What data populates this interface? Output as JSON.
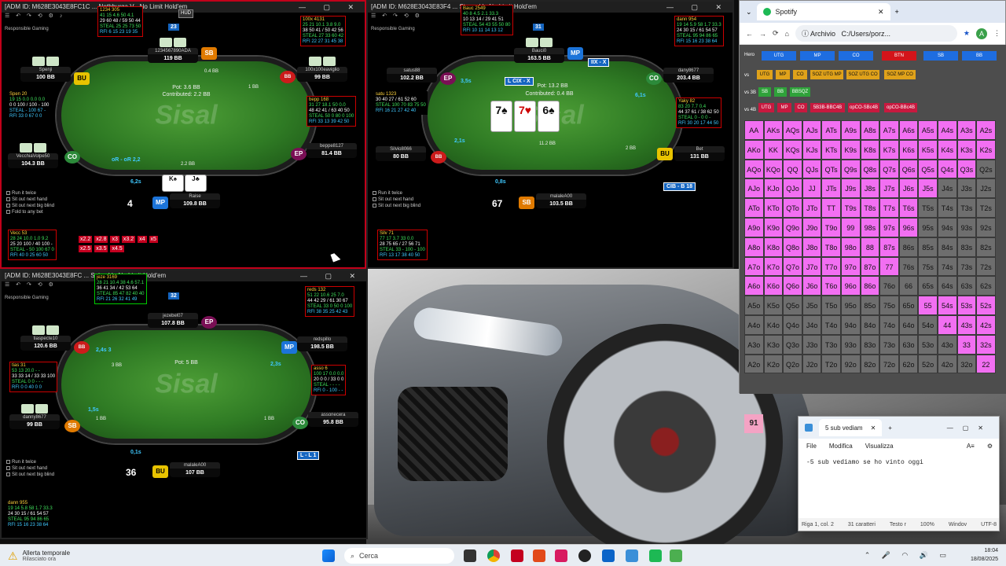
{
  "tables": [
    {
      "title": "[ADM ID: M628E3043E8FC1C",
      "title_tail": "Nothburga V - No Limit Hold'em",
      "hand_no": "4",
      "pot": "Pot: 3.6 BB",
      "contrib": "Contributed: 2.2 BB",
      "logo": "Sisal",
      "resp": "Responsible Gaming",
      "hero": {
        "name": "Raise",
        "stack": "109.8 BB",
        "pos": "MP"
      },
      "hero_cards": [
        "K♠",
        "J♣"
      ],
      "seats": [
        {
          "name": "1234567890ADA",
          "stack": "119 BB",
          "pos": "SB"
        },
        {
          "name": "Spenji",
          "stack": "100 BB",
          "pos": "BU"
        },
        {
          "name": "100x100eaviglio",
          "stack": "99 BB",
          "pos": "BB"
        },
        {
          "name": "VecchiaVolpe50",
          "stack": "104.3 BB",
          "pos": "CO"
        },
        {
          "name": "beppe8127",
          "stack": "81.4 BB",
          "pos": "EP"
        }
      ],
      "bets": [
        "0.4 BB",
        "1 BB",
        "2.2 BB"
      ],
      "timer": "6,2s",
      "range_label": "oR - oR 2,2",
      "num_badge": "23",
      "checks": [
        "Run it twice",
        "Sit out next hand",
        "Sit out next big blind",
        "Fold to any bet"
      ],
      "sizes": [
        "x2.2",
        "x2.8",
        "x3",
        "x3.2",
        "x4",
        "x5",
        "x2.5",
        "x3.5",
        "x4.5"
      ],
      "hud_left": [
        "Vecc 53",
        "28 24 10.0 1.0 9.2",
        "25 20 100 / 40 100 -",
        "STEAL - 50 100 67 0",
        "RFI 40 0 25 60 50"
      ],
      "hud_top": [
        "1234 305",
        "41 15 4.6 50 4.1",
        "29 60 48 / 59 50 44",
        "STEAL 25 25 73 50",
        "RFI 6 15 23 19 35"
      ],
      "hud_right": [
        "100x 4131",
        "25 21 10.1 3.8 9.0",
        "38 50 41 / 50 42 56",
        "STEAL 27 33 60 42",
        "RFI 22 27 31 45 38"
      ],
      "hud_spen": [
        "Spen 20",
        "19 15 0.0 0.0 0.0",
        "0 0 100 / 100 - 100",
        "STEAL - 100 67 -",
        "RFI 33 0 67 0 0"
      ],
      "hud_bepp": [
        "bepp 168",
        "31 27 18.1 50 0.0",
        "48 42 41 / 63 40 50",
        "STEAL 50 0 80 0 100",
        "RFI 33 13 39 42 50"
      ]
    },
    {
      "title": "[ADM ID: M628E3043E83F4",
      "title_tail": "Sirene V - No Limit Hold'em",
      "hand_no": "67",
      "pot": "Pot: 13.2 BB",
      "contrib": "Contributed: 0.4 BB",
      "logo": "Sisal",
      "resp": "Responsible Gaming",
      "hero": {
        "name": "malaleA00",
        "stack": "103.5 BB",
        "pos": "SB"
      },
      "board": [
        "7♠",
        "7♥",
        "6♠"
      ],
      "seats": [
        {
          "name": "Bauci0",
          "stack": "163.5 BB",
          "pos": "MP"
        },
        {
          "name": "satus88",
          "stack": "102.2 BB",
          "pos": "EP"
        },
        {
          "name": "dany8677",
          "stack": "203.4 BB",
          "pos": "CO"
        },
        {
          "name": "Silvio8066",
          "stack": "80 BB",
          "pos": "BB"
        },
        {
          "name": "Bet",
          "stack": "131 BB",
          "pos": "BU"
        }
      ],
      "bets": [
        "11.2 BB",
        "2 BB"
      ],
      "timer": "0,8s",
      "num_badge": "31",
      "range_label": "L CIX - X",
      "range_label2": "IIX - X",
      "range_label3": "CIB - B 18",
      "checks": [
        "Run it twice",
        "Sit out next hand",
        "Sit out next big blind"
      ],
      "hud_top": [
        "Bauc 2549",
        "40 8 4.5 2.1 33.3",
        "10 13 14 / 29 41 51",
        "STEAL 54 43 55 50 80",
        "RFI 10 11 14 13 12"
      ],
      "hud_right": [
        "dann 954",
        "19 14 5.9 58 1.7 33.3",
        "24 30 15 / 61 54 57",
        "STEAL 95 94 86 65",
        "RFI 15 16 23 38 64"
      ],
      "hud_left": [
        "satu 1323",
        "30 40 27 / 61 52 60",
        "STEAL 100 70 83 75 50",
        "RFI 16 21 27 42 40"
      ],
      "hud_yaky": [
        "Yaky 82",
        "83 20 7.7 0.4",
        "44 37 61 / 38 62 50",
        "STEAL 0 - 0 0 -",
        "RFI 30 20 17 44 50"
      ],
      "hud_silv": [
        "Silv 71",
        "77 17 3.7 33 0.0",
        "28 75 65 / 27 56 71",
        "STEAL 33 - 100 - 100",
        "RFI 13 17 38 40 50"
      ],
      "tm1": "3,5s",
      "tm2": "2,1s",
      "tm3": "6,1s"
    },
    {
      "title": "[ADM ID: M628E3043E8FC",
      "title_tail": "Saipn V - No Limit Hold'em",
      "hand_no": "36",
      "pot": "Pot: 5 BB",
      "logo": "Sisal",
      "resp": "Responsible Gaming",
      "hero": {
        "name": "malaleA00",
        "stack": "107 BB",
        "pos": "BU"
      },
      "seats": [
        {
          "name": "jezebel07",
          "stack": "107.8 BB",
          "pos": "EP"
        },
        {
          "name": "tiaspecte10",
          "stack": "120.6 BB",
          "pos": "BB"
        },
        {
          "name": "redspillo",
          "stack": "198.5 BB",
          "pos": "MP"
        },
        {
          "name": "danny8677",
          "stack": "99 BB",
          "pos": "SB"
        },
        {
          "name": "assonecera",
          "stack": "95.8 BB",
          "pos": "CO"
        }
      ],
      "bets": [
        "3 BB",
        "1 BB",
        "1 BB"
      ],
      "timer": "0,1s",
      "tm1": "2,4s 3",
      "tm2": "2,3s",
      "tm3": "1,5s",
      "num_badge": "32",
      "range_label": "L - L 1",
      "checks": [
        "Run it twice",
        "Sit out next hand",
        "Sit out next big blind"
      ],
      "hud_top": [
        "jeze 3169",
        "28 21 10.4 38 4.6 57.1",
        "36 41 34 / 42 53 64",
        "STEAL 85 47 82 40 40",
        "RFI 21 26 32 41 49"
      ],
      "hud_right": [
        "reds 132",
        "51 22 10.6 25 7.0",
        "44 42 29 / 61 30 67",
        "STEAL 33 0 50 0 100",
        "RFI 38 35 25 42 43"
      ],
      "hud_tias": [
        "tias 31",
        "53 13 20.0 - -",
        "33 33 14 / 33 33 100",
        "STEAL 0 0 - - -",
        "RFI 0 0 40 0 0"
      ],
      "hud_asso": [
        "asso 6",
        "100 17 0.0 0.0",
        "20 0 0 / 33 0 0",
        "STEAL - - - -",
        "RFI 0 - 100 - -"
      ],
      "hud_dann": [
        "dann 955",
        "19 14 5.8 58 1.7 33.3",
        "24 30 15 / 61 54 57",
        "STEAL 95 94 86 65",
        "RFI 15 16 23 38 64"
      ]
    }
  ],
  "hud_badge": "HUD",
  "browser": {
    "tab_title": "Spotify",
    "addr_label": "Archivio",
    "url": "C:/Users/porz...",
    "avatar": "A",
    "hero_label": "Hero",
    "hero_positions": [
      "UTG",
      "MP",
      "CO",
      "BTN",
      "SB",
      "BB"
    ],
    "vs_label": "vs",
    "vs_items": [
      "UTG",
      "MP",
      "CO",
      "SOZ UTG MP",
      "SOZ UTG CO",
      "SOZ MP CO"
    ],
    "vs3b_label": "vs 3B",
    "vs3b_items": [
      "SB",
      "BB",
      "BBSQZ"
    ],
    "vs4b_label": "vs 4B",
    "vs4b_items": [
      "UTG",
      "MP",
      "CO",
      "5B3B-BBC4B",
      "opCO-SBc4B",
      "opCO-BBc4B"
    ],
    "grid": [
      [
        "AA",
        "AKs",
        "AQs",
        "AJs",
        "ATs",
        "A9s",
        "A8s",
        "A7s",
        "A6s",
        "A5s",
        "A4s",
        "A3s",
        "A2s"
      ],
      [
        "AKo",
        "KK",
        "KQs",
        "KJs",
        "KTs",
        "K9s",
        "K8s",
        "K7s",
        "K6s",
        "K5s",
        "K4s",
        "K3s",
        "K2s"
      ],
      [
        "AQo",
        "KQo",
        "QQ",
        "QJs",
        "QTs",
        "Q9s",
        "Q8s",
        "Q7s",
        "Q6s",
        "Q5s",
        "Q4s",
        "Q3s",
        "Q2s"
      ],
      [
        "AJo",
        "KJo",
        "QJo",
        "JJ",
        "JTs",
        "J9s",
        "J8s",
        "J7s",
        "J6s",
        "J5s",
        "J4s",
        "J3s",
        "J2s"
      ],
      [
        "ATo",
        "KTo",
        "QTo",
        "JTo",
        "TT",
        "T9s",
        "T8s",
        "T7s",
        "T6s",
        "T5s",
        "T4s",
        "T3s",
        "T2s"
      ],
      [
        "A9o",
        "K9o",
        "Q9o",
        "J9o",
        "T9o",
        "99",
        "98s",
        "97s",
        "96s",
        "95s",
        "94s",
        "93s",
        "92s"
      ],
      [
        "A8o",
        "K8o",
        "Q8o",
        "J8o",
        "T8o",
        "98o",
        "88",
        "87s",
        "86s",
        "85s",
        "84s",
        "83s",
        "82s"
      ],
      [
        "A7o",
        "K7o",
        "Q7o",
        "J7o",
        "T7o",
        "97o",
        "87o",
        "77",
        "76s",
        "75s",
        "74s",
        "73s",
        "72s"
      ],
      [
        "A6o",
        "K6o",
        "Q6o",
        "J6o",
        "T6o",
        "96o",
        "86o",
        "76o",
        "66",
        "65s",
        "64s",
        "63s",
        "62s"
      ],
      [
        "A5o",
        "K5o",
        "Q5o",
        "J5o",
        "T5o",
        "95o",
        "85o",
        "75o",
        "65o",
        "55",
        "54s",
        "53s",
        "52s"
      ],
      [
        "A4o",
        "K4o",
        "Q4o",
        "J4o",
        "T4o",
        "94o",
        "84o",
        "74o",
        "64o",
        "54o",
        "44",
        "43s",
        "42s"
      ],
      [
        "A3o",
        "K3o",
        "Q3o",
        "J3o",
        "T3o",
        "93o",
        "83o",
        "73o",
        "63o",
        "53o",
        "43o",
        "33",
        "32s"
      ],
      [
        "A2o",
        "K2o",
        "Q2o",
        "J2o",
        "T2o",
        "92o",
        "82o",
        "72o",
        "62o",
        "52o",
        "42o",
        "32o",
        "22"
      ]
    ],
    "count": "91"
  },
  "notepad": {
    "tab": "5 sub vediam",
    "menu": [
      "File",
      "Modifica",
      "Visualizza"
    ],
    "body": "-5 sub vediamo se ho vinto oggi",
    "status": [
      "Riga 1, col. 2",
      "31 caratteri",
      "Testo r",
      "100%",
      "Windov",
      "UTF-8"
    ]
  },
  "taskbar": {
    "weather_title": "Allerta temporale",
    "weather_sub": "Rilasciato ora",
    "search": "Cerca",
    "time": "18:04",
    "date": "18/08/2025"
  }
}
